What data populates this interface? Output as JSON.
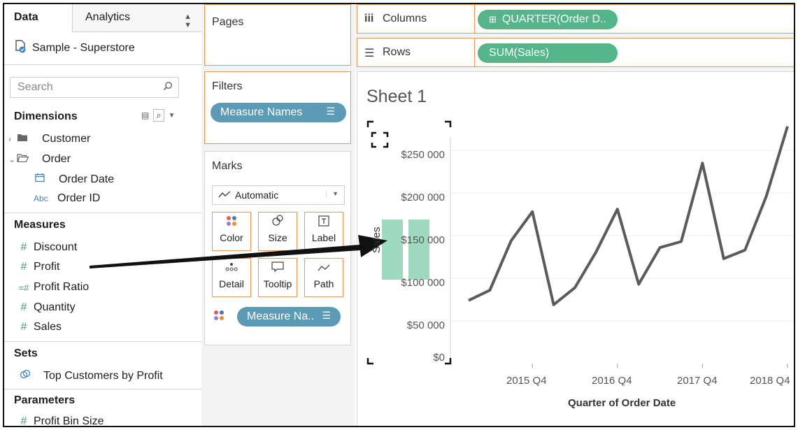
{
  "data_pane": {
    "tabs": {
      "data": "Data",
      "analytics": "Analytics"
    },
    "datasource": "Sample - Superstore",
    "search_placeholder": "Search",
    "dimensions_title": "Dimensions",
    "dimensions": [
      {
        "label": "Customer"
      },
      {
        "label": "Order"
      },
      {
        "label": "Order Date"
      },
      {
        "label": "Order ID",
        "prefix": "Abc"
      }
    ],
    "measures_title": "Measures",
    "measures": [
      "Discount",
      "Profit",
      "Profit Ratio",
      "Quantity",
      "Sales"
    ],
    "sets_title": "Sets",
    "sets": [
      "Top Customers by Profit"
    ],
    "parameters_title": "Parameters",
    "parameters": [
      "Profit Bin Size"
    ]
  },
  "shelves": {
    "pages": "Pages",
    "filters": "Filters",
    "filter_pill": "Measure Names",
    "marks": "Marks",
    "mark_type": "Automatic",
    "cards": [
      "Color",
      "Size",
      "Label",
      "Detail",
      "Tooltip",
      "Path"
    ],
    "marks_pill": "Measure Na..",
    "columns": "Columns",
    "columns_pill": "QUARTER(Order D..",
    "rows": "Rows",
    "rows_pill": "SUM(Sales)"
  },
  "colors": {
    "shelf_border": "#e8965a",
    "pill_blue": "#5b9bb5",
    "pill_green": "#53b589",
    "line": "#5b5b5f",
    "drop_target": "#8fd4b3"
  },
  "chart_data": {
    "type": "line",
    "title": "Sheet 1",
    "ylabel": "Sales",
    "xlabel": "Quarter of Order Date",
    "yticks": [
      "$250 000",
      "$200 000",
      "$150 000",
      "$100 000",
      "$50 000",
      "$0"
    ],
    "ylim": [
      0,
      275000
    ],
    "x_tick_labels": [
      "2015 Q4",
      "2016 Q4",
      "2017 Q4",
      "2018 Q4"
    ],
    "x": [
      "2015 Q1",
      "2015 Q2",
      "2015 Q3",
      "2015 Q4",
      "2016 Q1",
      "2016 Q2",
      "2016 Q3",
      "2016 Q4",
      "2017 Q1",
      "2017 Q2",
      "2017 Q3",
      "2017 Q4",
      "2018 Q1",
      "2018 Q2",
      "2018 Q3",
      "2018 Q4"
    ],
    "series": [
      {
        "values": [
          74000,
          86000,
          144000,
          178000,
          69000,
          89000,
          131000,
          181000,
          93000,
          136000,
          143000,
          235000,
          123000,
          133000,
          196000,
          278000
        ]
      }
    ],
    "grid": true
  }
}
